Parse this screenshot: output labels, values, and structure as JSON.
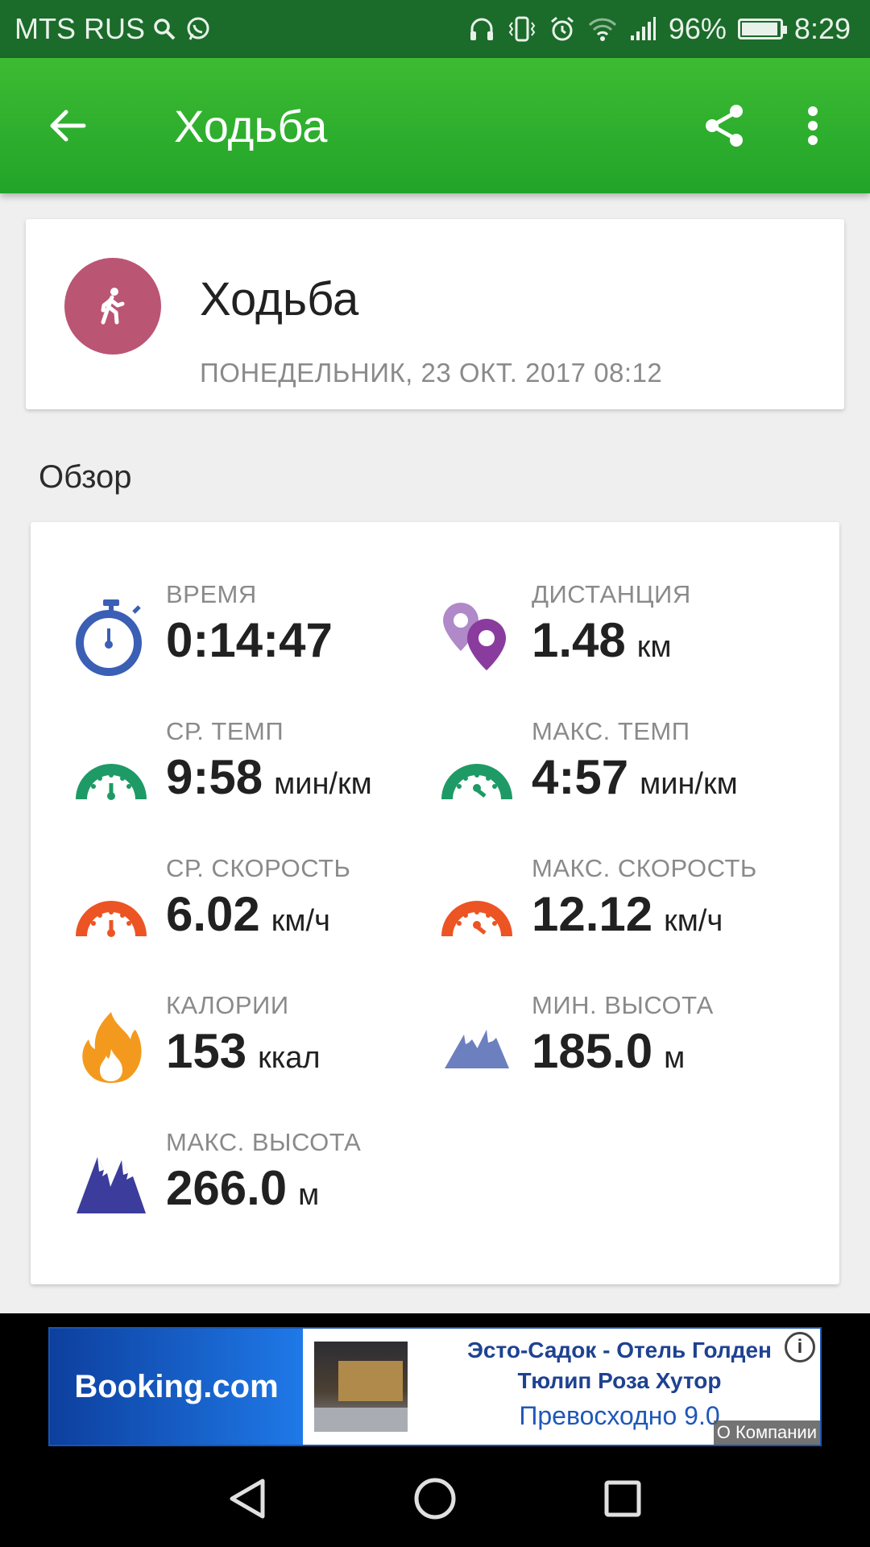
{
  "status_bar": {
    "carrier": "MTS RUS",
    "battery_pct": "96%",
    "time": "8:29",
    "battery_level": 0.96,
    "icons": [
      "search-icon",
      "whatsapp-icon",
      "headphones-icon",
      "vibrate-icon",
      "alarm-icon",
      "wifi-icon",
      "signal-icon",
      "battery-icon"
    ]
  },
  "app_bar": {
    "title": "Ходьба",
    "back_icon": "arrow-left-icon",
    "share_icon": "share-icon",
    "menu_icon": "more-vert-icon",
    "color": "#2eaf2e"
  },
  "activity": {
    "name": "Ходьба",
    "date": "ПОНЕДЕЛЬНИК, 23 ОКТ. 2017 08:12",
    "icon": "walking-icon",
    "color": "#bb5574"
  },
  "overview": {
    "title": "Обзор",
    "stats": [
      {
        "label": "ВРЕМЯ",
        "value": "0:14:47",
        "unit": "",
        "icon": "stopwatch-icon"
      },
      {
        "label": "ДИСТАНЦИЯ",
        "value": "1.48",
        "unit": "км",
        "icon": "map-pins-icon"
      },
      {
        "label": "СР. ТЕМП",
        "value": "9:58",
        "unit": "мин/км",
        "icon": "avg-pace-gauge-icon"
      },
      {
        "label": "МАКС. ТЕМП",
        "value": "4:57",
        "unit": "мин/км",
        "icon": "max-pace-gauge-icon"
      },
      {
        "label": "СР. СКОРОСТЬ",
        "value": "6.02",
        "unit": "км/ч",
        "icon": "avg-speed-gauge-icon"
      },
      {
        "label": "МАКС. СКОРОСТЬ",
        "value": "12.12",
        "unit": "км/ч",
        "icon": "max-speed-gauge-icon"
      },
      {
        "label": "КАЛОРИИ",
        "value": "153",
        "unit": "ккал",
        "icon": "flame-icon"
      },
      {
        "label": "МИН. ВЫСОТА",
        "value": "185.0",
        "unit": "м",
        "icon": "mountains-min-icon"
      },
      {
        "label": "МАКС. ВЫСОТА",
        "value": "266.0",
        "unit": "м",
        "icon": "mountains-max-icon"
      }
    ]
  },
  "ad": {
    "brand": "Booking.com",
    "hotel_line1": "Эсто-Садок - Отель Голден",
    "hotel_line2": "Тюлип Роза Хутор",
    "rating": "Превосходно 9.0",
    "about": "О Компании",
    "info_icon": "info-icon"
  },
  "nav_bar": {
    "back": "nav-back-icon",
    "home": "nav-home-icon",
    "recents": "nav-recents-icon"
  }
}
